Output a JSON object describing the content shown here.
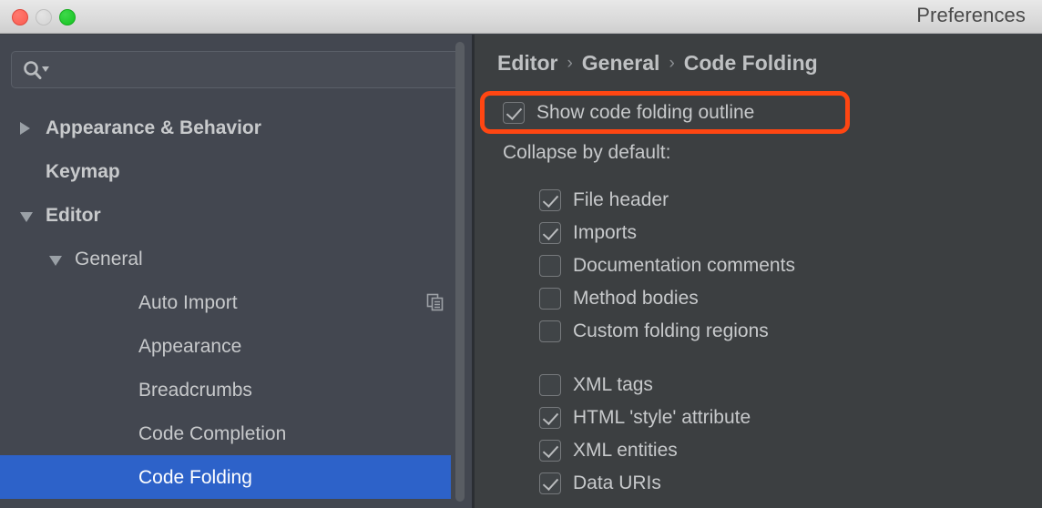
{
  "window": {
    "title": "Preferences",
    "traffic_lights": [
      {
        "name": "close",
        "color": "#fb5c50"
      },
      {
        "name": "minimize",
        "color": "#d3d3d3"
      },
      {
        "name": "zoom",
        "color": "#15c221"
      }
    ]
  },
  "sidebar": {
    "search": {
      "value": "",
      "placeholder": "",
      "icon": "search-icon"
    },
    "items": [
      {
        "label": "Appearance & Behavior",
        "level": 0,
        "twisty": "right",
        "bold": true,
        "selected": false,
        "aux_icon": ""
      },
      {
        "label": "Keymap",
        "level": 0,
        "twisty": "none",
        "bold": true,
        "selected": false,
        "aux_icon": ""
      },
      {
        "label": "Editor",
        "level": 0,
        "twisty": "down",
        "bold": true,
        "selected": false,
        "aux_icon": ""
      },
      {
        "label": "General",
        "level": 1,
        "twisty": "down",
        "bold": false,
        "selected": false,
        "aux_icon": ""
      },
      {
        "label": "Auto Import",
        "level": 2,
        "twisty": "none",
        "bold": false,
        "selected": false,
        "aux_icon": "copy-icon"
      },
      {
        "label": "Appearance",
        "level": 2,
        "twisty": "none",
        "bold": false,
        "selected": false,
        "aux_icon": ""
      },
      {
        "label": "Breadcrumbs",
        "level": 2,
        "twisty": "none",
        "bold": false,
        "selected": false,
        "aux_icon": ""
      },
      {
        "label": "Code Completion",
        "level": 2,
        "twisty": "none",
        "bold": false,
        "selected": false,
        "aux_icon": ""
      },
      {
        "label": "Code Folding",
        "level": 2,
        "twisty": "none",
        "bold": false,
        "selected": true,
        "aux_icon": ""
      }
    ],
    "selection_color": "#2d62c9",
    "background_color": "#434750"
  },
  "panel": {
    "breadcrumb": {
      "parts": [
        "Editor",
        "General",
        "Code Folding"
      ],
      "separator": "›"
    },
    "highlight": {
      "color": "#ff4612",
      "target": "show-code-folding-outline"
    },
    "show_outline": {
      "label": "Show code folding outline",
      "checked": true
    },
    "section_label": "Collapse by default:",
    "options_group_1": [
      {
        "label": "File header",
        "checked": true
      },
      {
        "label": "Imports",
        "checked": true
      },
      {
        "label": "Documentation comments",
        "checked": false
      },
      {
        "label": "Method bodies",
        "checked": false
      },
      {
        "label": "Custom folding regions",
        "checked": false
      }
    ],
    "options_group_2": [
      {
        "label": "XML tags",
        "checked": false
      },
      {
        "label": "HTML 'style' attribute",
        "checked": true
      },
      {
        "label": "XML entities",
        "checked": true
      },
      {
        "label": "Data URIs",
        "checked": true
      }
    ],
    "background_color": "#3c3f41"
  }
}
